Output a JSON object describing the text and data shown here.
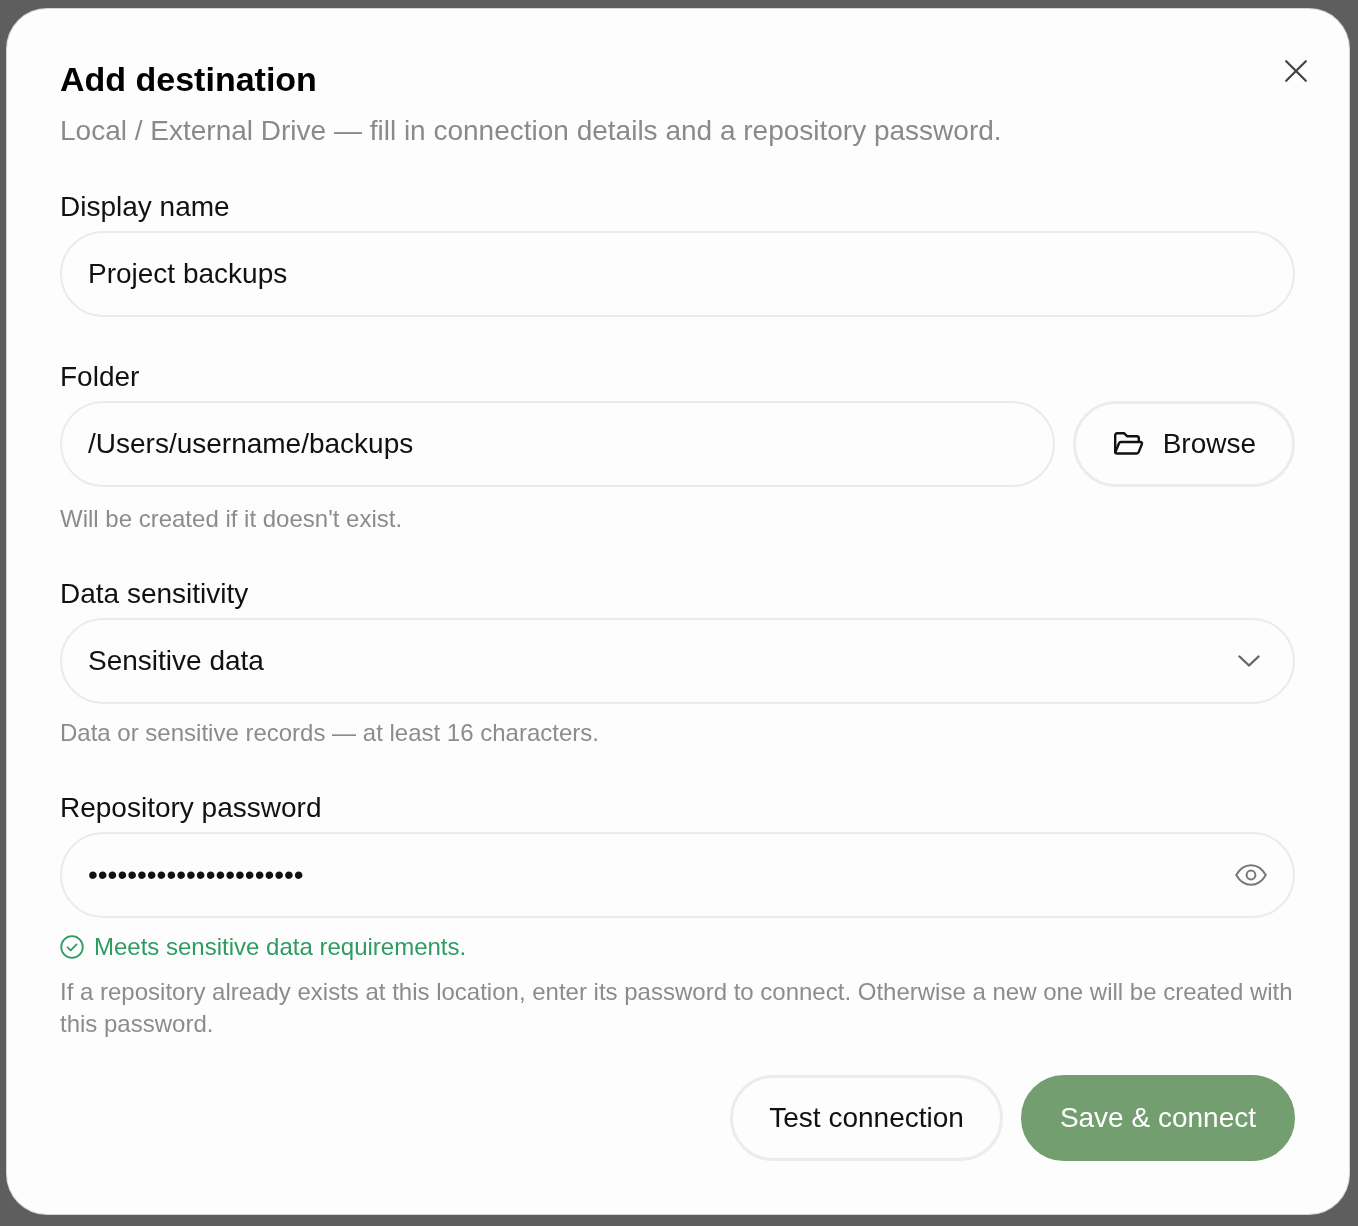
{
  "dialog": {
    "title": "Add destination",
    "subtitle": "Local / External Drive — fill in connection details and a repository password."
  },
  "fields": [
    {
      "kind": "text",
      "label": "Display name",
      "value": "Project backups"
    },
    {
      "kind": "path",
      "label": "Folder",
      "value": "/Users/username/backups",
      "button": "Browse",
      "hint": "Will be created if it doesn't exist."
    },
    {
      "kind": "select",
      "label": "Data sensitivity",
      "value": "Sensitive data",
      "hint": "Data or sensitive records — at least 16 characters."
    },
    {
      "kind": "password",
      "label": "Repository password",
      "value": "••••••••••••••••••••••",
      "status": {
        "kind": "success",
        "text": "Meets sensitive data requirements."
      },
      "note": "If a repository already exists at this location, enter its password to connect. Otherwise a new one will be created with this password."
    }
  ],
  "buttons": [
    {
      "kind": "secondary",
      "label": "Test connection"
    },
    {
      "kind": "primary",
      "label": "Save & connect"
    }
  ]
}
